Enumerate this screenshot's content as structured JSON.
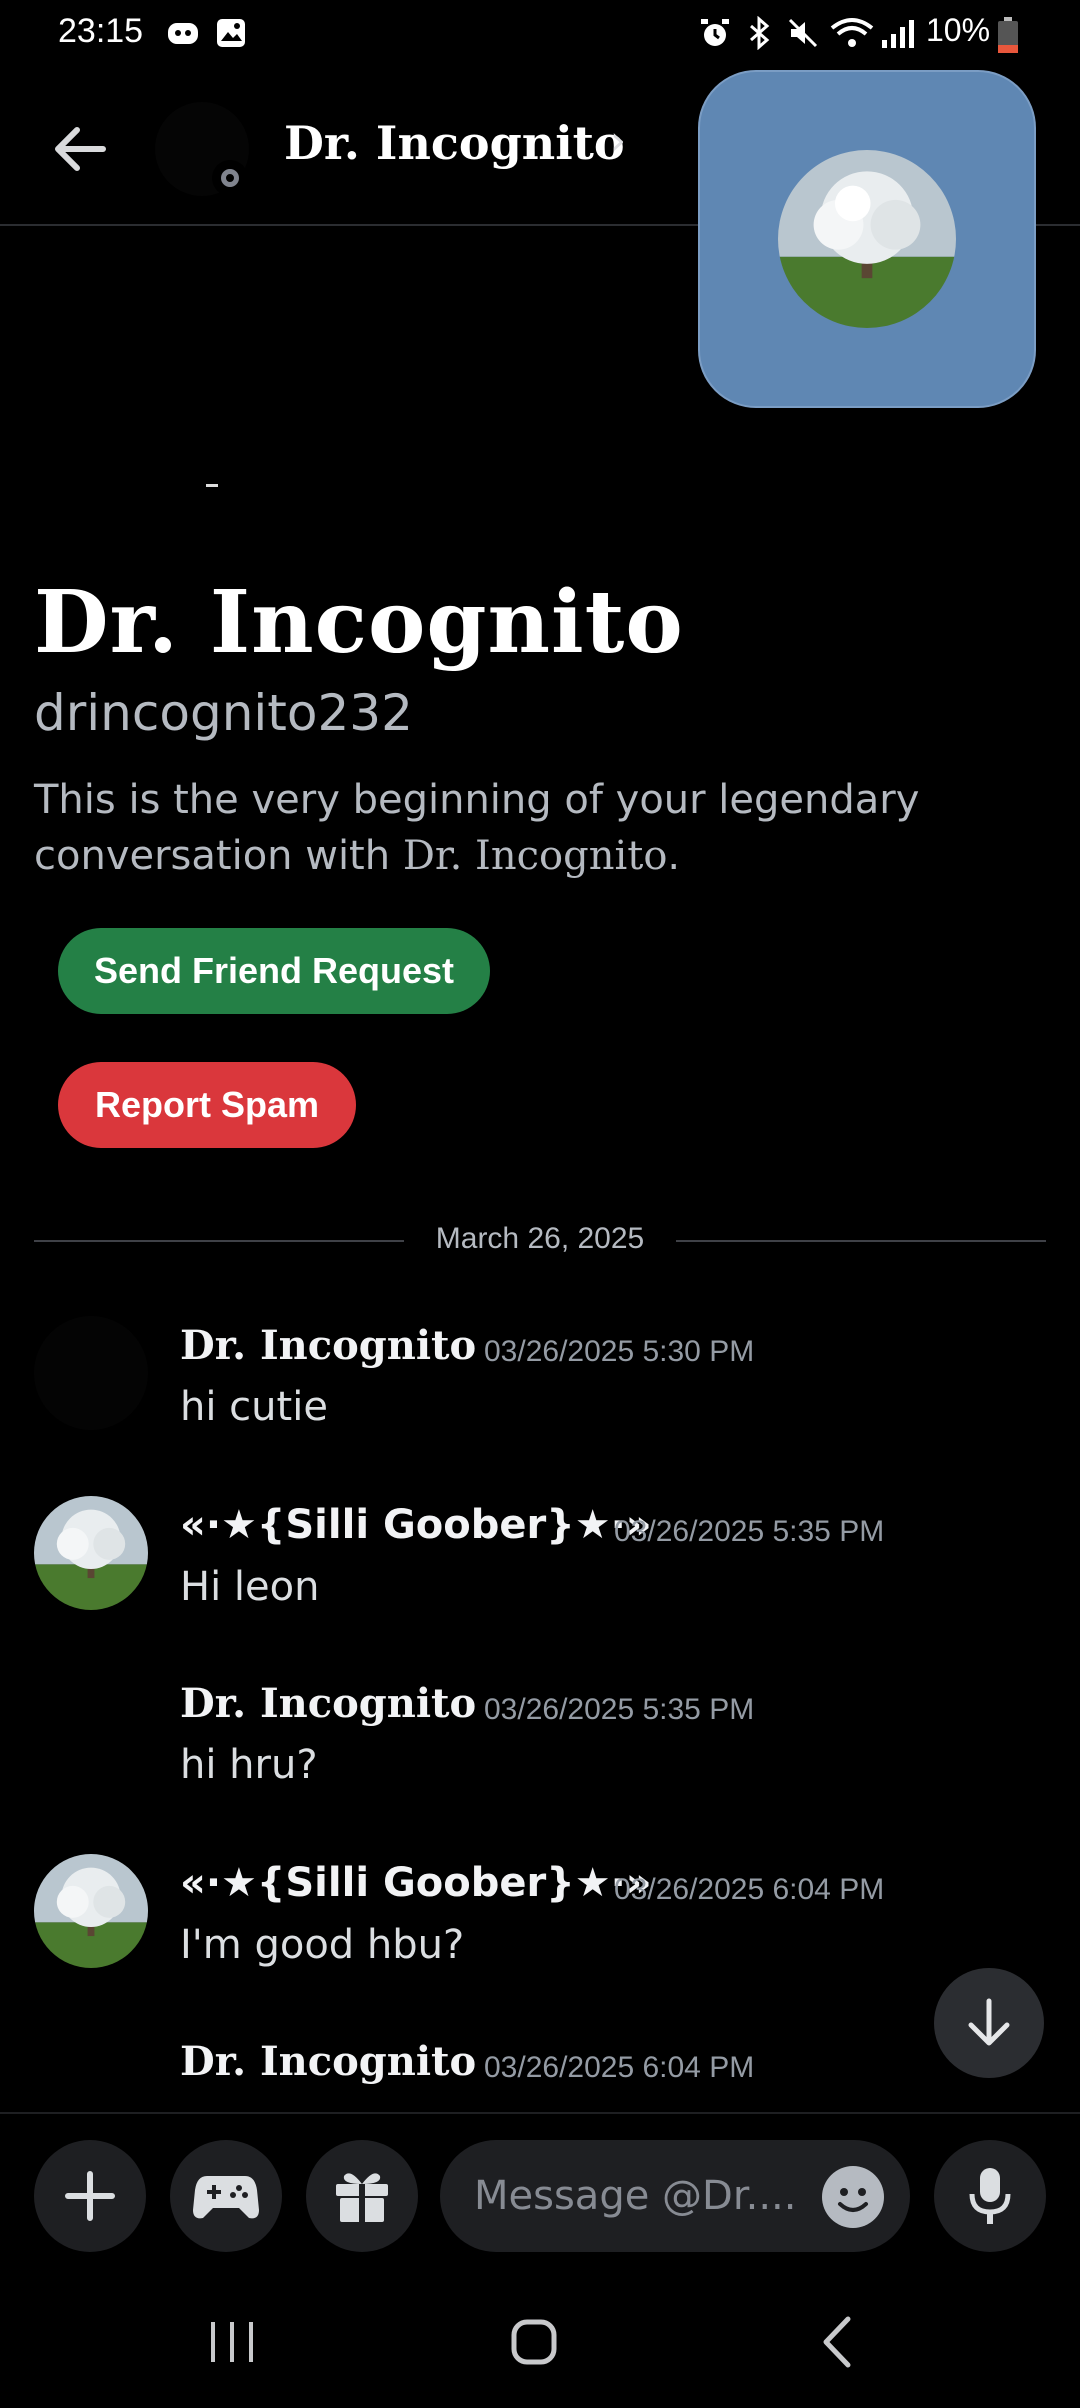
{
  "status_bar": {
    "time": "23:15",
    "battery": "10%"
  },
  "header": {
    "name": "Dr. Incognito",
    "chevron": "›"
  },
  "intro": {
    "name": "Dr. Incognito",
    "username": "drincognito232",
    "text_prefix": "This is the very beginning of your legendary conversation with ",
    "text_name": "Dr. Incognito",
    "text_suffix": "."
  },
  "actions": {
    "friend_label": "Send Friend Request",
    "spam_label": "Report Spam"
  },
  "date_divider": "March 26, 2025",
  "messages": [
    {
      "author": "Dr. Incognito",
      "timestamp": "03/26/2025 5:30 PM",
      "text": "hi cutie"
    },
    {
      "author": "«·★{Silli Goober}★·»",
      "timestamp": "03/26/2025 5:35 PM",
      "text": "Hi leon"
    },
    {
      "author": "Dr. Incognito",
      "timestamp": "03/26/2025 5:35 PM",
      "text": "hi hru?"
    },
    {
      "author": "«·★{Silli Goober}★·»",
      "timestamp": "03/26/2025 6:04 PM",
      "text": "I'm good hbu?"
    },
    {
      "author": "Dr. Incognito",
      "timestamp": "03/26/2025 6:04 PM",
      "text": ""
    }
  ],
  "composer": {
    "placeholder": "Message @Dr...."
  },
  "colors": {
    "background": "#000000",
    "friend_button": "#248046",
    "spam_button": "#da373c",
    "pip_background": "#5f87b3"
  },
  "icons": [
    "arrow-left-icon",
    "chevron-right-icon",
    "arrow-down-icon",
    "plus-icon",
    "gamepad-icon",
    "gift-icon",
    "emoji-icon",
    "microphone-icon"
  ]
}
